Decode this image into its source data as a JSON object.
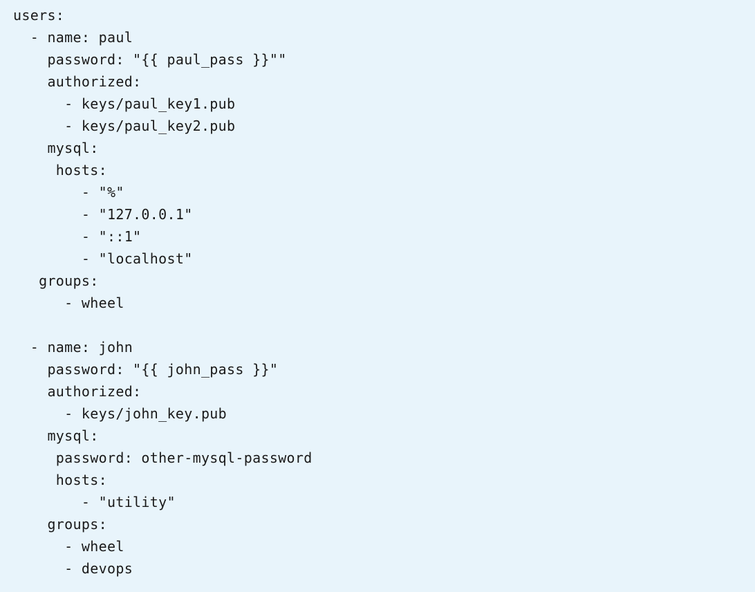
{
  "document": {
    "kind": "yaml-source-listing",
    "background_color": "#e8f4fb",
    "text_color": "#1a1a1a",
    "font_size_px": 20,
    "line_height_px": 32
  },
  "code": {
    "language": "yaml",
    "root_key": "users",
    "lines": [
      "users:",
      "  - name: paul",
      "    password: \"{{ paul_pass }}\"\"",
      "    authorized:",
      "      - keys/paul_key1.pub",
      "      - keys/paul_key2.pub",
      "    mysql:",
      "     hosts:",
      "        - \"%\"",
      "        - \"127.0.0.1\"",
      "        - \"::1\"",
      "        - \"localhost\"",
      "   groups:",
      "      - wheel",
      "",
      "  - name: john",
      "    password: \"{{ john_pass }}\"",
      "    authorized:",
      "      - keys/john_key.pub",
      "    mysql:",
      "     password: other-mysql-password",
      "     hosts:",
      "        - \"utility\"",
      "    groups:",
      "      - wheel",
      "      - devops"
    ],
    "entries": [
      {
        "name": "paul",
        "password": "\"{{ paul_pass }}\"\"",
        "authorized": [
          "keys/paul_key1.pub",
          "keys/paul_key2.pub"
        ],
        "mysql": {
          "hosts": [
            "\"%\"",
            "\"127.0.0.1\"",
            "\"::1\"",
            "\"localhost\""
          ]
        },
        "groups": [
          "wheel"
        ]
      },
      {
        "name": "john",
        "password": "\"{{ john_pass }}\"",
        "authorized": [
          "keys/john_key.pub"
        ],
        "mysql": {
          "password": "other-mysql-password",
          "hosts": [
            "\"utility\""
          ]
        },
        "groups": [
          "wheel",
          "devops"
        ]
      }
    ]
  }
}
